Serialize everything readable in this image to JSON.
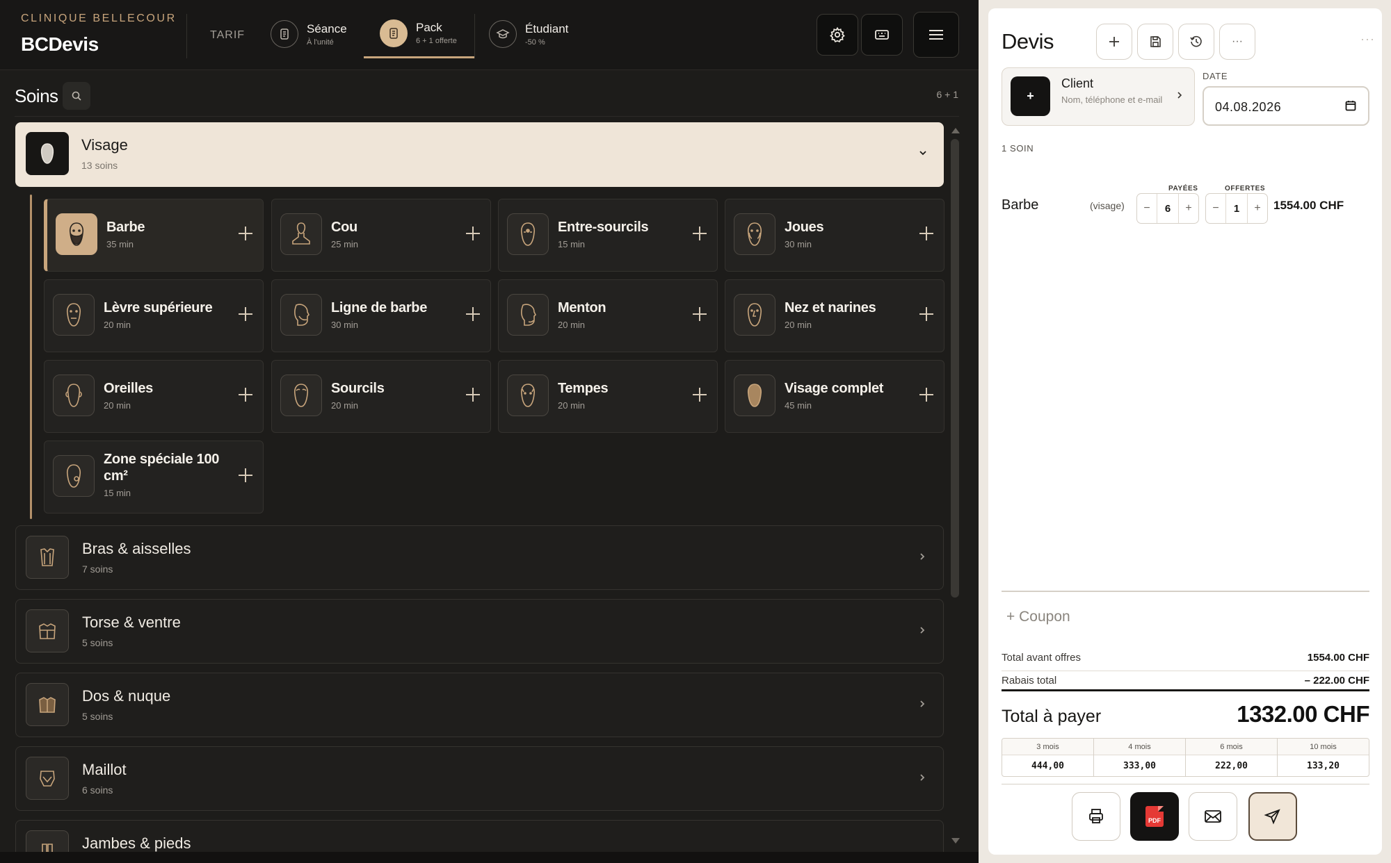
{
  "brand": {
    "subtitle": "CLINIQUE BELLECOUR",
    "title": "BCDevis"
  },
  "tarif": {
    "label": "TARIF",
    "modes": [
      {
        "title": "Séance",
        "sub": "À l'unité",
        "icon": "receipt-icon"
      },
      {
        "title": "Pack",
        "sub": "6 + 1 offerte",
        "icon": "pack-icon",
        "active": true
      },
      {
        "title": "Étudiant",
        "sub": "-50 %",
        "icon": "graduation-cap-icon"
      }
    ]
  },
  "toolbar": {
    "settings": "gear-icon",
    "keyboard": "keyboard-icon",
    "menu": "hamburger-icon"
  },
  "soins": {
    "title": "Soins",
    "pack_badge": "6 + 1",
    "open_category": {
      "name": "Visage",
      "count": "13 soins"
    },
    "items": [
      {
        "name": "Barbe",
        "duration": "35 min",
        "selected": true
      },
      {
        "name": "Cou",
        "duration": "25 min"
      },
      {
        "name": "Entre-sourcils",
        "duration": "15 min"
      },
      {
        "name": "Joues",
        "duration": "30 min"
      },
      {
        "name": "Lèvre supérieure",
        "duration": "20 min"
      },
      {
        "name": "Ligne de barbe",
        "duration": "30 min"
      },
      {
        "name": "Menton",
        "duration": "20 min"
      },
      {
        "name": "Nez et narines",
        "duration": "20 min"
      },
      {
        "name": "Oreilles",
        "duration": "20 min"
      },
      {
        "name": "Sourcils",
        "duration": "20 min"
      },
      {
        "name": "Tempes",
        "duration": "20 min"
      },
      {
        "name": "Visage complet",
        "duration": "45 min"
      },
      {
        "name": "Zone spéciale 100 cm²",
        "duration": "15 min"
      }
    ],
    "categories": [
      {
        "name": "Bras & aisselles",
        "count": "7 soins"
      },
      {
        "name": "Torse & ventre",
        "count": "5 soins"
      },
      {
        "name": "Dos & nuque",
        "count": "5 soins"
      },
      {
        "name": "Maillot",
        "count": "6 soins"
      },
      {
        "name": "Jambes & pieds",
        "count": ""
      }
    ]
  },
  "devis": {
    "title": "Devis",
    "more": "···",
    "client": {
      "label": "Client",
      "hint": "Nom, téléphone et e-mail",
      "add": "+"
    },
    "date": {
      "label": "DATE",
      "value": "04.08.2026"
    },
    "count": "1 SOIN",
    "columns": {
      "paid": "PAYÉES",
      "offered": "OFFERTES"
    },
    "line": {
      "name": "Barbe",
      "zone": "(visage)",
      "paid": "6",
      "offered": "1",
      "price": "1554.00 CHF"
    },
    "coupon": "Coupon",
    "subtotal": {
      "label": "Total avant offres",
      "value": "1554.00 CHF"
    },
    "discount": {
      "label": "Rabais total",
      "value": "– 222.00 CHF"
    },
    "total": {
      "label": "Total à payer",
      "value": "1332.00 CHF"
    },
    "installments": [
      {
        "months": "3 mois",
        "amount": "444,00"
      },
      {
        "months": "4 mois",
        "amount": "333,00"
      },
      {
        "months": "6 mois",
        "amount": "222,00"
      },
      {
        "months": "10 mois",
        "amount": "133,20"
      }
    ],
    "pdf_label": "PDF"
  }
}
